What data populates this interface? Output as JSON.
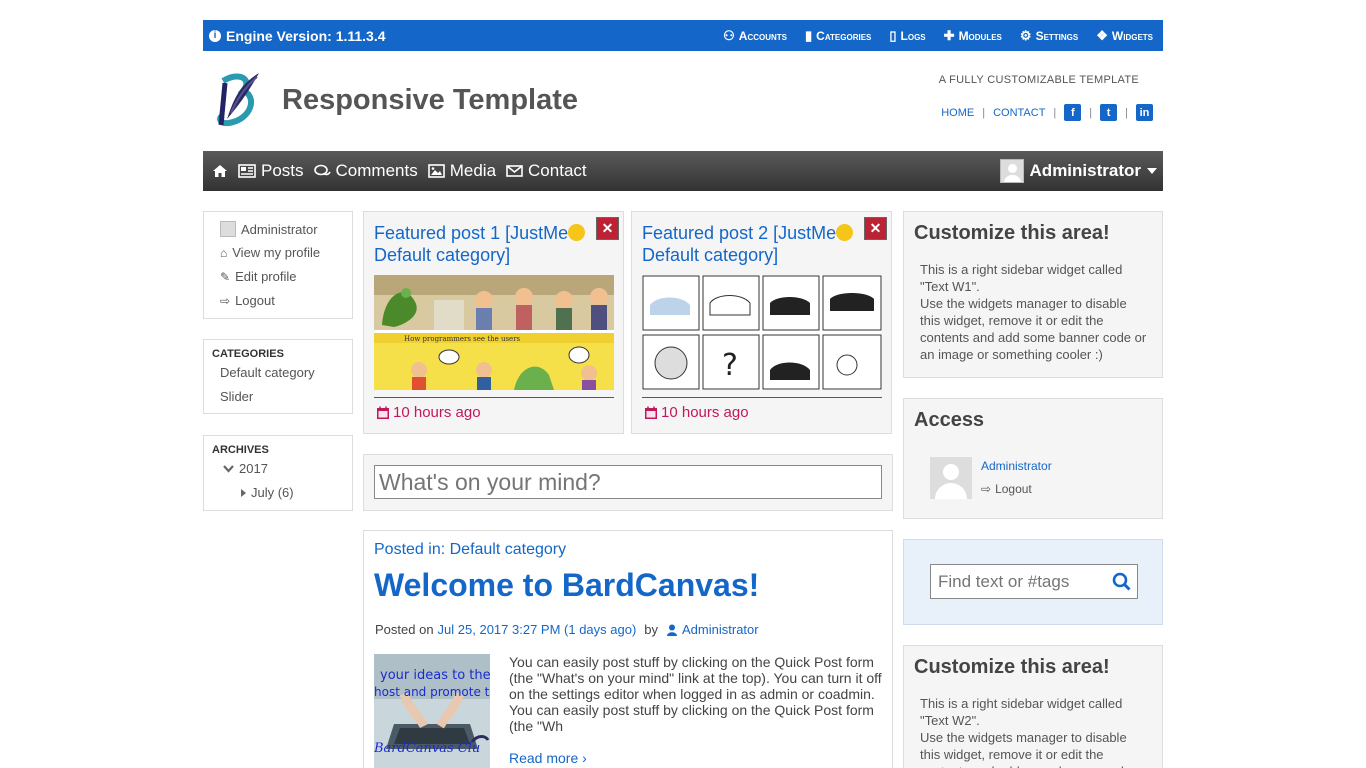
{
  "adminbar": {
    "version": "Engine Version: 1.11.3.4",
    "menu": [
      {
        "label": "Accounts",
        "icon": "users-icon"
      },
      {
        "label": "Categories",
        "icon": "folder-icon"
      },
      {
        "label": "Logs",
        "icon": "file-icon"
      },
      {
        "label": "Modules",
        "icon": "puzzle-icon"
      },
      {
        "label": "Settings",
        "icon": "gears-icon"
      },
      {
        "label": "Widgets",
        "icon": "cubes-icon"
      }
    ]
  },
  "header": {
    "site_title": "Responsive Template",
    "slogan": "A FULLY CUSTOMIZABLE TEMPLATE",
    "links": {
      "home": "HOME",
      "contact": "CONTACT",
      "sep": "|"
    },
    "social": {
      "facebook": "f",
      "twitter": "t",
      "linkedin": "in"
    }
  },
  "mainnav": {
    "items": [
      "Posts",
      "Comments",
      "Media",
      "Contact"
    ],
    "user": "Administrator"
  },
  "left": {
    "user": {
      "name": "Administrator",
      "view_profile": "View my profile",
      "edit_profile": "Edit profile",
      "logout": "Logout"
    },
    "categories": {
      "heading": "CATEGORIES",
      "items": [
        "Default category",
        "Slider"
      ]
    },
    "archives": {
      "heading": "ARCHIVES",
      "year": "2017",
      "month": "July (6)"
    }
  },
  "featured": [
    {
      "title": "Featured post 1 [JustMe",
      "title2": "Default category]",
      "time": "10 hours ago"
    },
    {
      "title": "Featured post 2 [JustMe",
      "title2": "Default category]",
      "time": "10 hours ago"
    }
  ],
  "quickpost": {
    "placeholder": "What's on your mind?"
  },
  "post": {
    "category_prefix": "Posted in:",
    "category": "Default category",
    "title": "Welcome to BardCanvas!",
    "posted_on": "Posted on",
    "date": "Jul 25, 2017 3:27 PM (1 days ago)",
    "by": "by",
    "author": "Administrator",
    "excerpt": "You can easily post stuff by clicking on the Quick Post form (the \"What's on your mind\" link at the top). You can turn it off on the settings editor when logged in as admin or coadmin. You can easily post stuff by clicking on the Quick Post form (the \"Wh",
    "read_more": "Read more ›",
    "thumb_text1": "your ideas to the",
    "thumb_text2": "host and promote th",
    "thumb_text3": "BardCanvas Clu"
  },
  "right": {
    "w1": {
      "title": "Customize this area!",
      "text1": "This is a right sidebar widget called \"Text W1\".",
      "text2": "Use the widgets manager to disable this widget, remove it or edit the contents and add some banner code or an image or something cooler :)"
    },
    "access": {
      "title": "Access",
      "name": "Administrator",
      "logout": "Logout"
    },
    "search": {
      "placeholder": "Find text or #tags"
    },
    "w2": {
      "title": "Customize this area!",
      "text1": "This is a right sidebar widget called \"Text W2\".",
      "text2": "Use the widgets manager to disable this widget, remove it or edit the contents and add some banner code or an image or"
    }
  },
  "colors": {
    "primary": "#1467c8",
    "nav_dark": "#3a3a3a",
    "time": "#c2185b",
    "close": "#b22233"
  }
}
